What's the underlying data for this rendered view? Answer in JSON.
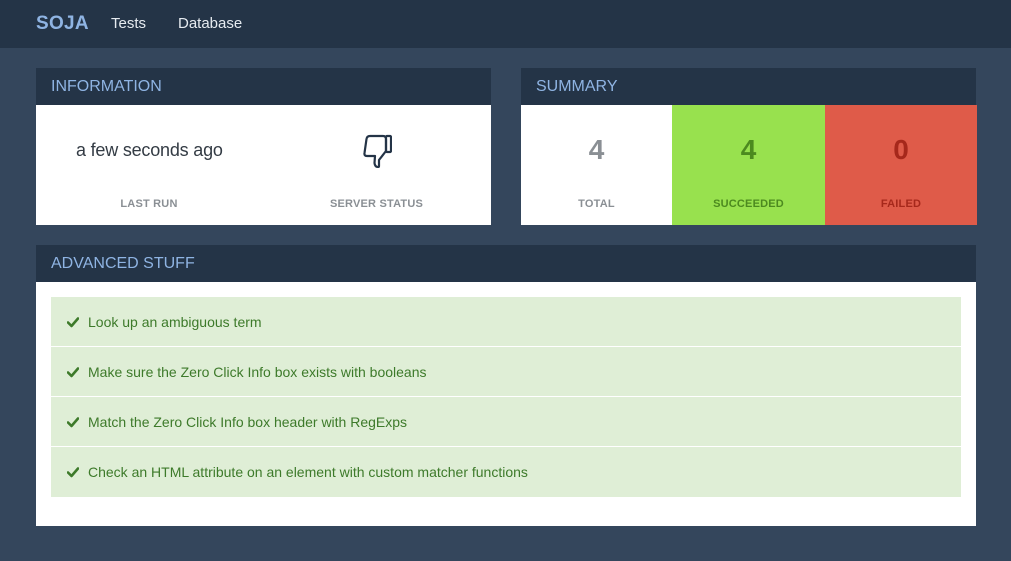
{
  "nav": {
    "brand": "SOJA",
    "links": [
      "Tests",
      "Database"
    ]
  },
  "information": {
    "title": "INFORMATION",
    "last_run_value": "a few seconds ago",
    "last_run_label": "LAST RUN",
    "server_status_icon": "thumbs-down-icon",
    "server_status_label": "SERVER STATUS"
  },
  "summary": {
    "title": "SUMMARY",
    "total": {
      "value": "4",
      "label": "TOTAL"
    },
    "succeeded": {
      "value": "4",
      "label": "SUCCEEDED"
    },
    "failed": {
      "value": "0",
      "label": "FAILED"
    }
  },
  "advanced": {
    "title": "ADVANCED STUFF",
    "tests": [
      {
        "label": "Look up an ambiguous term",
        "status": "passed"
      },
      {
        "label": "Make sure the Zero Click Info box exists with booleans",
        "status": "passed"
      },
      {
        "label": "Match the Zero Click Info box header with RegExps",
        "status": "passed"
      },
      {
        "label": "Check an HTML attribute on an element with custom matcher functions",
        "status": "passed"
      }
    ]
  },
  "colors": {
    "navbar": "#243447",
    "background": "#34465c",
    "accent": "#8fb4e3",
    "success": "#98e14e",
    "failure": "#df5b49",
    "test_row": "#dfeed6"
  }
}
